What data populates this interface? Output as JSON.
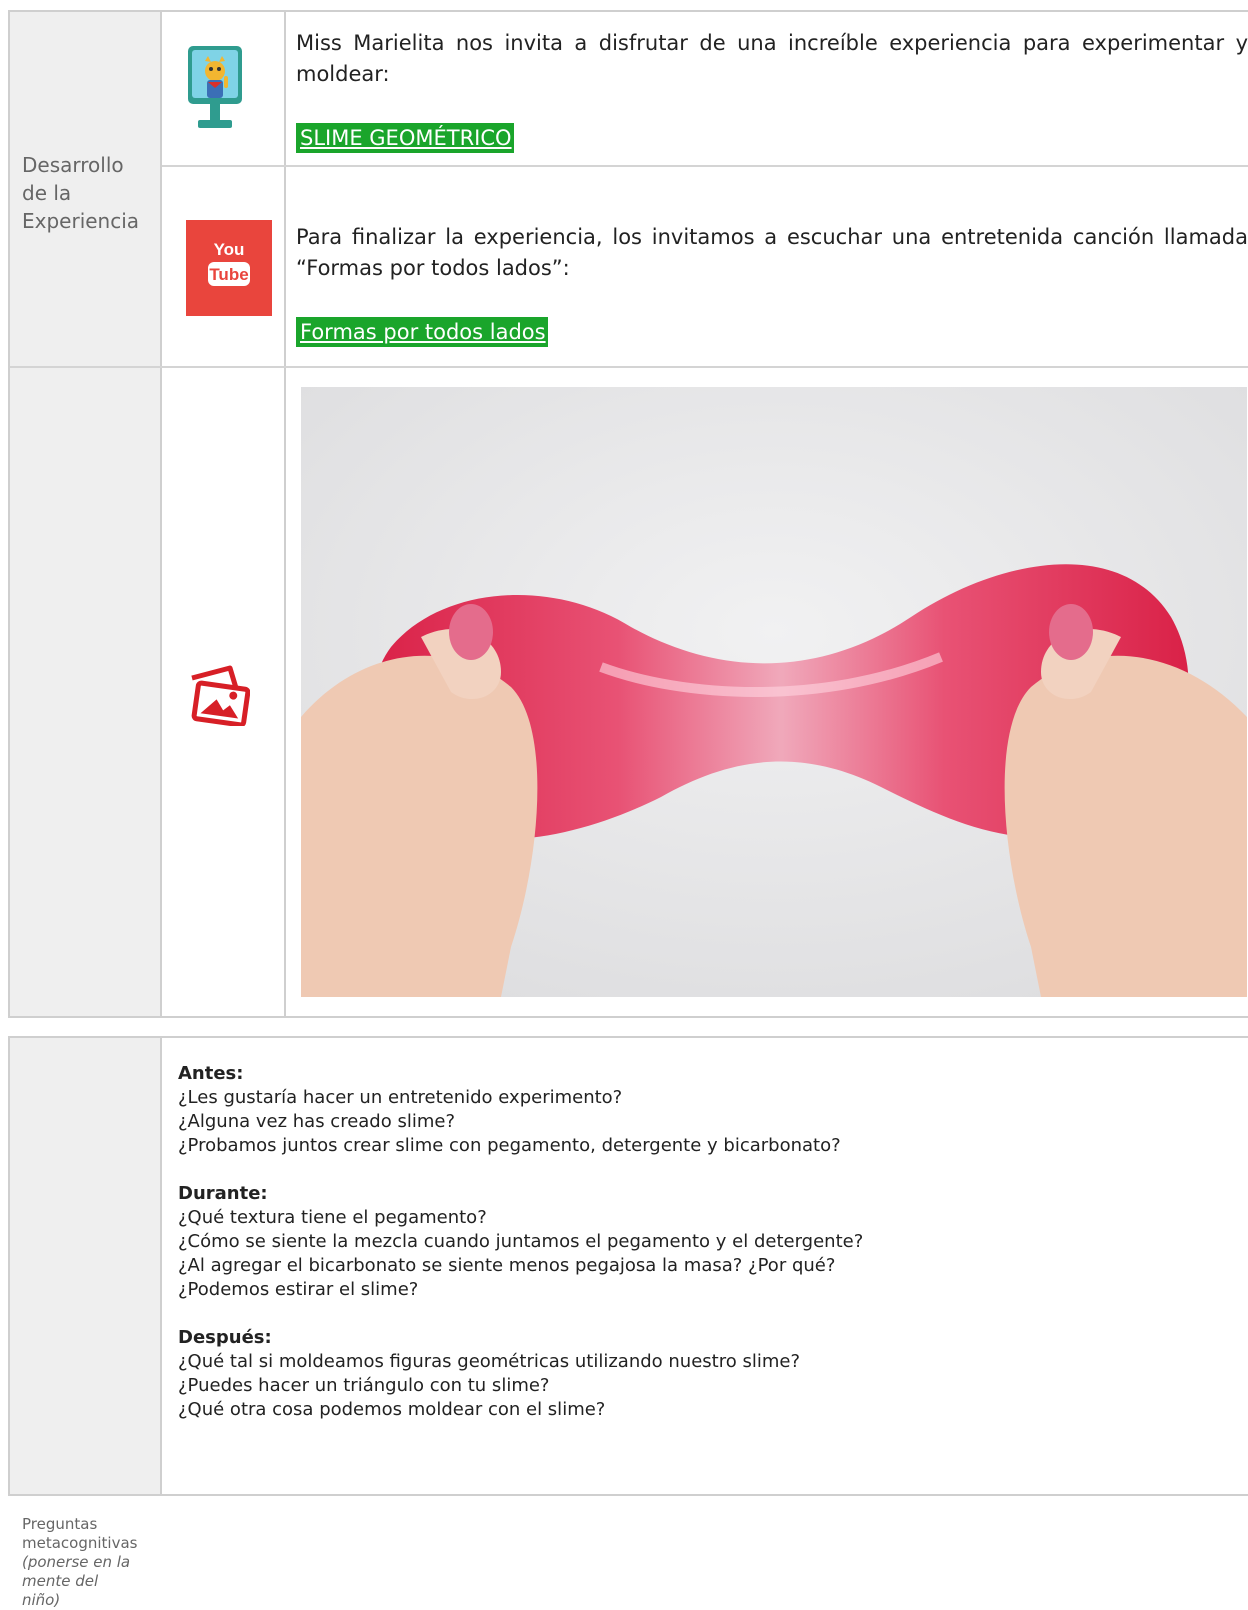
{
  "section1": {
    "label_lines": [
      "Desarrollo",
      "de la",
      "Experiencia"
    ],
    "row1": {
      "icon": "computer-monitor-icon",
      "text": "Miss Marielita nos invita a disfrutar de una increíble experiencia para experimentar y moldear:",
      "link": "SLIME GEOMÉTRICO"
    },
    "row2": {
      "icon": "youtube-icon",
      "icon_text_top": "You",
      "icon_text_bottom": "Tube",
      "text": "Para finalizar la experiencia, los invitamos a escuchar una entretenida canción llamada “Formas por todos lados”:",
      "link": "Formas por todos lados"
    },
    "row3": {
      "icon": "image-gallery-icon",
      "photo": "photo-hands-stretching-pink-glitter-slime"
    }
  },
  "section2": {
    "label_lines": [
      "Preguntas",
      "metacognitivas"
    ],
    "label_italic_lines": [
      "(ponerse en la",
      "mente del",
      "niño)"
    ],
    "groups": [
      {
        "heading": "Antes:",
        "questions": [
          "¿Les gustaría hacer un entretenido experimento?",
          "¿Alguna vez has creado slime?",
          "¿Probamos juntos crear slime con pegamento, detergente y bicarbonato?"
        ]
      },
      {
        "heading": "Durante:",
        "questions": [
          "¿Qué textura tiene el pegamento?",
          "¿Cómo se siente la mezcla cuando juntamos el pegamento y el detergente?",
          "¿Al agregar el bicarbonato se siente menos pegajosa la masa? ¿Por qué?",
          "¿Podemos estirar el slime?"
        ]
      },
      {
        "heading": "Después:",
        "questions": [
          "¿Qué tal si moldeamos figuras geométricas utilizando nuestro slime?",
          "¿Puedes hacer un triángulo con tu slime?",
          "¿Qué otra cosa podemos moldear con el slime?"
        ]
      }
    ]
  },
  "colors": {
    "link_bg": "#1aa52b",
    "youtube_red": "#e9453d",
    "label_bg": "#efefef",
    "border": "#cfcfcf",
    "icon_red": "#d71f26"
  }
}
